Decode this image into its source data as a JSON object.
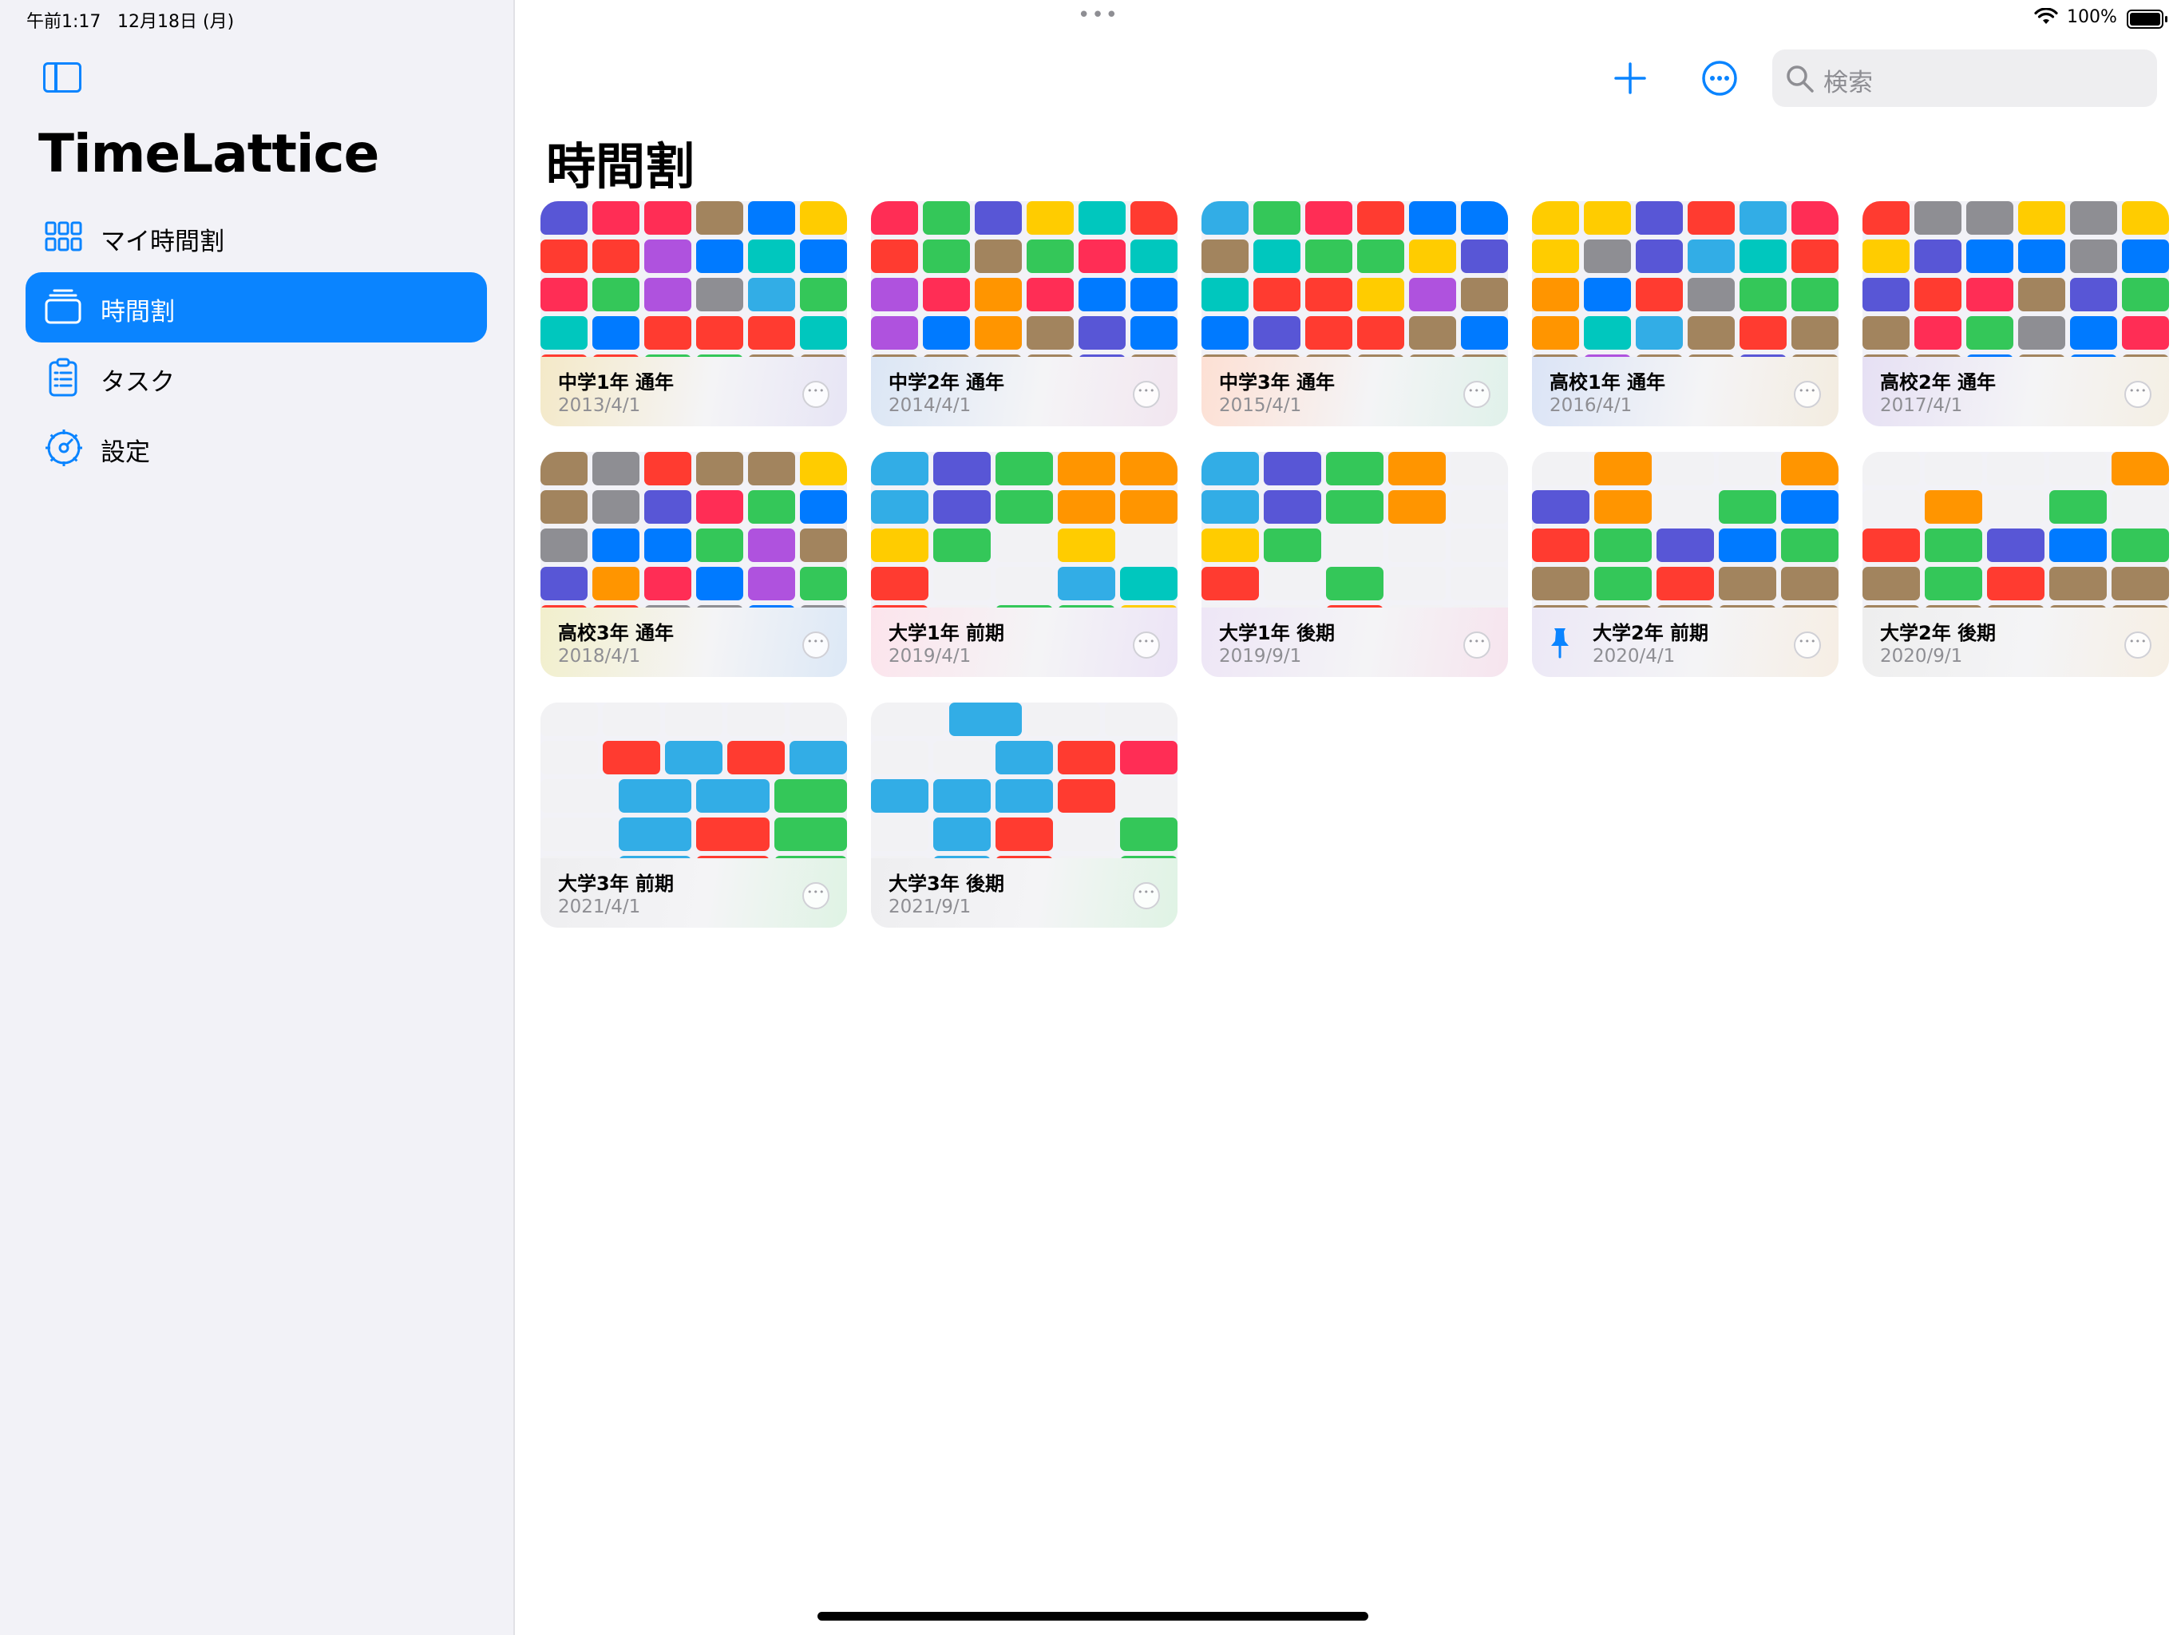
{
  "status_bar": {
    "time": "午前1:17",
    "date": "12月18日 (月)",
    "battery": "100%"
  },
  "sidebar": {
    "app_name": "TimeLattice",
    "items": [
      {
        "label": "マイ時間割",
        "icon": "grid-icon",
        "selected": false
      },
      {
        "label": "時間割",
        "icon": "stack-icon",
        "selected": true
      },
      {
        "label": "タスク",
        "icon": "clipboard-icon",
        "selected": false
      },
      {
        "label": "設定",
        "icon": "gear-icon",
        "selected": false
      }
    ]
  },
  "toolbar": {
    "add_icon": "plus-icon",
    "more_icon": "ellipsis-circle-icon",
    "search_placeholder": "検索"
  },
  "main": {
    "title": "時間割"
  },
  "palette": {
    "i": "#5856d6",
    "r": "#ff2d55",
    "t": "#ff3b30",
    "b": "#007aff",
    "c": "#32ade6",
    "n": "#00c7be",
    "g": "#34c759",
    "y": "#ffcc00",
    "o": "#ff9500",
    "p": "#af52de",
    "k": "#a2845e",
    "a": "#8e8e93",
    "e": "#f2f2f4",
    "accent": "#0a84ff"
  },
  "timetables": [
    {
      "title": "中学1年 通年",
      "date": "2013/4/1",
      "pinned": false,
      "tint": [
        "#f4e9c8",
        "#e7e5f5"
      ],
      "grid": [
        "irrkby",
        "ttpbnb",
        "rgpacg",
        "nbtttn",
        "ttggkk"
      ]
    },
    {
      "title": "中学2年 通年",
      "date": "2014/4/1",
      "pinned": false,
      "tint": [
        "#dbe6f5",
        "#f2e6f0"
      ],
      "grid": [
        "rgiynt",
        "tgkgrn",
        "prorbb",
        "pbokib",
        "kkkkik"
      ]
    },
    {
      "title": "中学3年 通年",
      "date": "2015/4/1",
      "pinned": false,
      "tint": [
        "#fde0d4",
        "#e0f1ea"
      ],
      "grid": [
        "cgrtbb",
        "knggyi",
        "nttypk",
        "bittkb",
        "kkkkkk"
      ]
    },
    {
      "title": "高校1年 通年",
      "date": "2016/4/1",
      "pinned": false,
      "tint": [
        "#dbe4f6",
        "#f3ece0"
      ],
      "grid": [
        "yyitcr",
        "yaicnt",
        "obtagg",
        "oncktk",
        "kpkkik"
      ]
    },
    {
      "title": "高校2年 通年",
      "date": "2017/4/1",
      "pinned": false,
      "tint": [
        "#e6e0f4",
        "#f4efe4"
      ],
      "grid": [
        "taayay",
        "yibbab",
        "itrkig",
        "krgabr",
        "kkbkbk"
      ]
    },
    {
      "title": "高校3年 通年",
      "date": "2018/4/1",
      "pinned": false,
      "tint": [
        "#f2efcc",
        "#dce8f6"
      ],
      "grid": [
        "katkky",
        "kairgb",
        "abbgpk",
        "iorbpg",
        "ttaaba"
      ]
    },
    {
      "title": "大学1年 前期",
      "date": "2019/4/1",
      "pinned": false,
      "tint": [
        "#fce4ec",
        "#ece4f6"
      ],
      "grid": [
        "cigoo",
        "cigoo",
        "ygeye",
        "teecn",
        "teggy"
      ]
    },
    {
      "title": "大学1年 後期",
      "date": "2019/9/1",
      "pinned": false,
      "tint": [
        "#eee6f6",
        "#f6e4ee"
      ],
      "grid": [
        "cigoe",
        "cigoe",
        "ygeee",
        "tegee",
        "eetee"
      ]
    },
    {
      "title": "大学2年 前期",
      "date": "2020/4/1",
      "pinned": true,
      "tint": [
        "#ece8f6",
        "#f6eee4"
      ],
      "grid": [
        "eoeeo",
        "ioegb",
        "tgibg",
        "kgtkk",
        "kkkkk"
      ]
    },
    {
      "title": "大学2年 後期",
      "date": "2020/9/1",
      "pinned": false,
      "tint": [
        "#eeeeee",
        "#f6efe4"
      ],
      "grid": [
        "eeeeo",
        "eoege",
        "tgibg",
        "kgtkk",
        "kkkkk"
      ]
    },
    {
      "title": "大学3年 前期",
      "date": "2021/4/1",
      "pinned": false,
      "tint": [
        "#eeeef0",
        "#dff3e4"
      ],
      "grid": [
        "eeeee",
        "etctc",
        "eccg",
        "ectg",
        "ectg"
      ]
    },
    {
      "title": "大学3年 後期",
      "date": "2021/9/1",
      "pinned": false,
      "tint": [
        "#eeeef0",
        "#dff3e4"
      ],
      "grid": [
        "ecee",
        "eectr",
        "cccte",
        "ecteg",
        "ecteg"
      ]
    }
  ]
}
